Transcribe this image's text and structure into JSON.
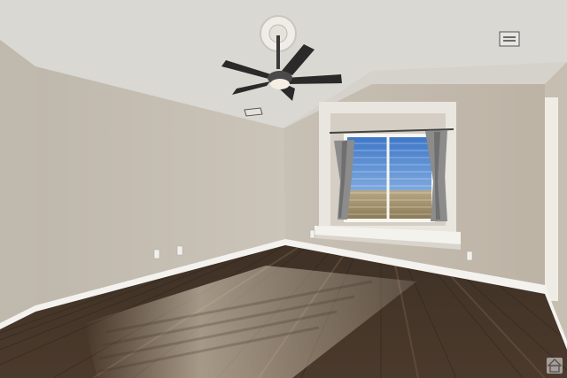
{
  "scene": {
    "description_colors": {
      "ceiling": "#dcdad5",
      "wall_left": "#c9c3b8",
      "wall_right": "#bdb4a6",
      "floor": "#4e3c2c",
      "trim": "#f3f1ec",
      "curtain": "#8e8e8e",
      "sky": "#5f8fd0"
    }
  }
}
